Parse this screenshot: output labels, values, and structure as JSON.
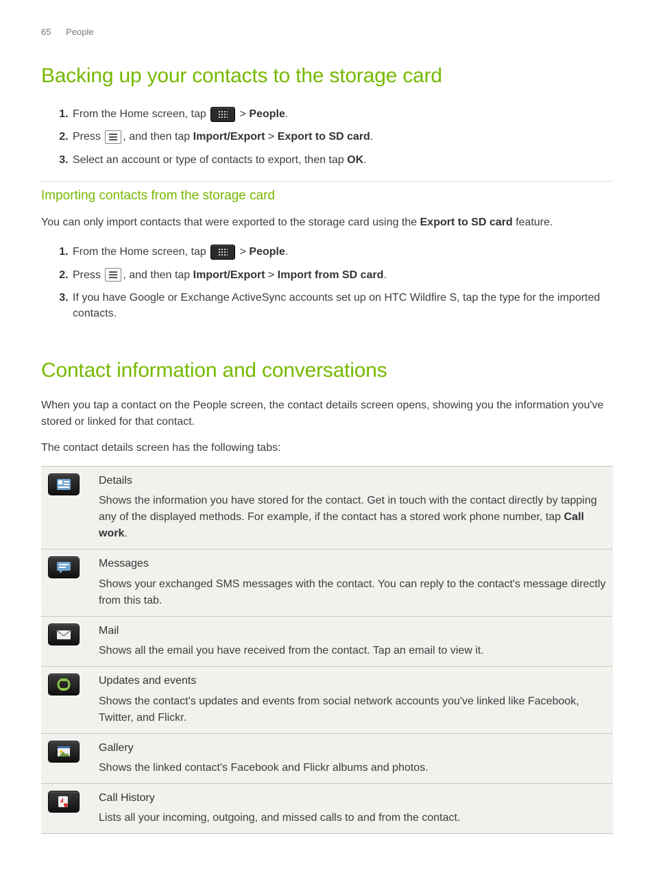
{
  "header": {
    "page_number": "65",
    "section": "People"
  },
  "h1_backup": "Backing up your contacts to the storage card",
  "backup_steps": {
    "s1a": "From the Home screen, tap ",
    "s1b": " > ",
    "s1c": "People",
    "s1d": ".",
    "s2a": "Press ",
    "s2b": ", and then tap ",
    "s2c": "Import/Export",
    "s2d": " > ",
    "s2e": "Export to SD card",
    "s2f": ".",
    "s3a": "Select an account or type of contacts to export, then tap ",
    "s3b": "OK",
    "s3c": "."
  },
  "h2_import": "Importing contacts from the storage card",
  "import_intro_a": "You can only import contacts that were exported to the storage card using the ",
  "import_intro_b": "Export to SD card",
  "import_intro_c": " feature.",
  "import_steps": {
    "s1a": "From the Home screen, tap ",
    "s1b": " > ",
    "s1c": "People",
    "s1d": ".",
    "s2a": "Press ",
    "s2b": ", and then tap ",
    "s2c": "Import/Export",
    "s2d": " > ",
    "s2e": "Import from SD card",
    "s2f": ".",
    "s3": "If you have Google or Exchange ActiveSync accounts set up on HTC Wildfire S, tap the type for the imported contacts."
  },
  "h1_contact": "Contact information and conversations",
  "contact_p1": "When you tap a contact on the People screen, the contact details screen opens, showing you the information you've stored or linked for that contact.",
  "contact_p2": "The contact details screen has the following tabs:",
  "tabs": [
    {
      "icon": "details",
      "title": "Details",
      "desc_a": "Shows the information you have stored for the contact. Get in touch with the contact directly by tapping any of the displayed methods. For example, if the contact has a stored work phone number, tap ",
      "desc_b": "Call work",
      "desc_c": "."
    },
    {
      "icon": "messages",
      "title": "Messages",
      "desc_a": "Shows your exchanged SMS messages with the contact. You can reply to the contact's message directly from this tab.",
      "desc_b": "",
      "desc_c": ""
    },
    {
      "icon": "mail",
      "title": "Mail",
      "desc_a": "Shows all the email you have received from the contact. Tap an email to view it.",
      "desc_b": "",
      "desc_c": ""
    },
    {
      "icon": "updates",
      "title": "Updates and events",
      "desc_a": "Shows the contact's updates and events from social network accounts you've linked like Facebook, Twitter, and Flickr.",
      "desc_b": "",
      "desc_c": ""
    },
    {
      "icon": "gallery",
      "title": "Gallery",
      "desc_a": "Shows the linked contact's Facebook and Flickr albums and photos.",
      "desc_b": "",
      "desc_c": ""
    },
    {
      "icon": "callhistory",
      "title": "Call History",
      "desc_a": "Lists all your incoming, outgoing, and missed calls to and from the contact.",
      "desc_b": "",
      "desc_c": ""
    }
  ]
}
